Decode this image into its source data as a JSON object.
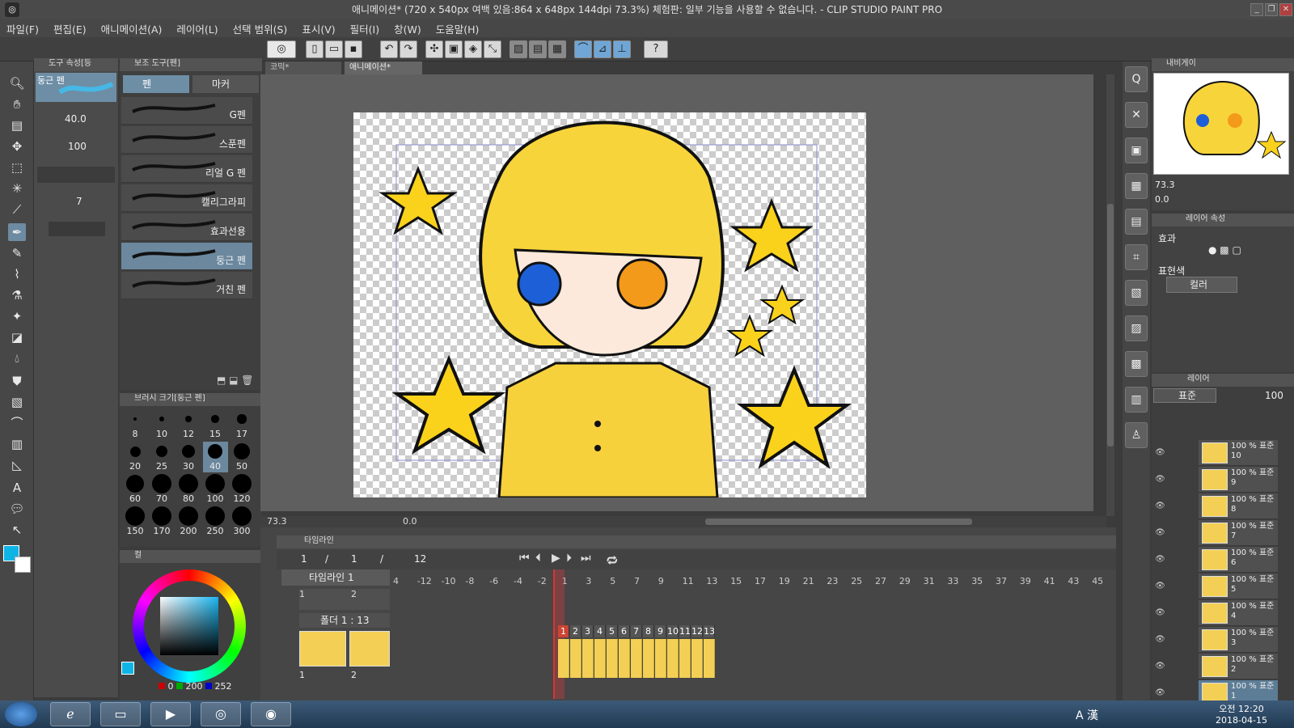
{
  "window": {
    "title": "애니메이션* (720 x 540px 여백 있음:864 x 648px 144dpi 73.3%)  체험판: 일부 기능을 사용할 수 없습니다. - CLIP STUDIO PAINT PRO",
    "app_icon": "clip-studio-icon",
    "minimize": "_",
    "maximize": "❐",
    "close": "✕"
  },
  "menu": [
    "파일(F)",
    "편집(E)",
    "애니메이션(A)",
    "레이어(L)",
    "선택 범위(S)",
    "표시(V)",
    "필터(I)",
    "창(W)",
    "도움말(H)"
  ],
  "toolbar": {
    "help": "?"
  },
  "tool_property": {
    "header": "도구 속성[등",
    "brush_name": "둥근 펜",
    "size_value": "40.0",
    "opacity_value": "100",
    "aa_value": "7"
  },
  "subtool": {
    "header": "보조 도구[펜]",
    "tab_pen": "펜",
    "tab_marker": "마커",
    "brushes": [
      "G펜",
      "스푼펜",
      "리얼 G 펜",
      "캘리그라피",
      "효과선용",
      "둥근 펜",
      "거친 펜"
    ],
    "selected_index": 5
  },
  "brush_size": {
    "header": "브러시 크기[둥근 펜]",
    "sizes": [
      "8",
      "10",
      "12",
      "15",
      "17",
      "20",
      "25",
      "30",
      "40",
      "50",
      "60",
      "70",
      "80",
      "100",
      "120",
      "150",
      "170",
      "200",
      "250",
      "300"
    ],
    "selected": "40"
  },
  "color": {
    "tab_label": "컬",
    "r": "0",
    "g": "200",
    "b": "252",
    "main_color": "#0fb4e6"
  },
  "canvas": {
    "tabs": [
      "코믹*",
      "애니메이션*"
    ],
    "zoom": "73.3",
    "rotation": "0.0"
  },
  "timeline": {
    "header": "타임라인",
    "current_frame": "1",
    "start_frame": "1",
    "end_frame": "12",
    "timeline_name": "타임라인 1",
    "ruler": [
      "4",
      "-12",
      "-10",
      "-8",
      "-6",
      "-4",
      "-2",
      "1",
      "3",
      "5",
      "7",
      "9",
      "11",
      "13",
      "15",
      "17",
      "19",
      "21",
      "23",
      "25",
      "27",
      "29",
      "31",
      "33",
      "35",
      "37",
      "39",
      "41",
      "43",
      "45"
    ],
    "camera_keys": [
      "1",
      "2"
    ],
    "folder_name": "폴더 1 : 13",
    "folder_keys": [
      "1",
      "2"
    ],
    "frames": [
      "1",
      "2",
      "3",
      "4",
      "5",
      "6",
      "7",
      "8",
      "9",
      "10",
      "11",
      "12",
      "13"
    ]
  },
  "navigator": {
    "header": "내비게이",
    "zoom": "73.3",
    "rotation": "0.0"
  },
  "layer_property": {
    "header": "레이어 속성",
    "effect_label": "효과",
    "expression_label": "표현색",
    "expression_value": "컬러"
  },
  "layers": {
    "header": "레이어",
    "blend_mode": "표준",
    "opacity": "100",
    "items": [
      {
        "top_label": "100 % 표준",
        "name": "10"
      },
      {
        "top_label": "100 % 표준",
        "name": "9"
      },
      {
        "top_label": "100 % 표준",
        "name": "8"
      },
      {
        "top_label": "100 % 표준",
        "name": "7"
      },
      {
        "top_label": "100 % 표준",
        "name": "6"
      },
      {
        "top_label": "100 % 표준",
        "name": "5"
      },
      {
        "top_label": "100 % 표준",
        "name": "4"
      },
      {
        "top_label": "100 % 표준",
        "name": "3"
      },
      {
        "top_label": "100 % 표준",
        "name": "2"
      },
      {
        "top_label": "100 % 표준",
        "name": "1"
      }
    ]
  },
  "taskbar": {
    "time": "오전 12:20",
    "date": "2018-04-15",
    "ime": "A 漢"
  }
}
